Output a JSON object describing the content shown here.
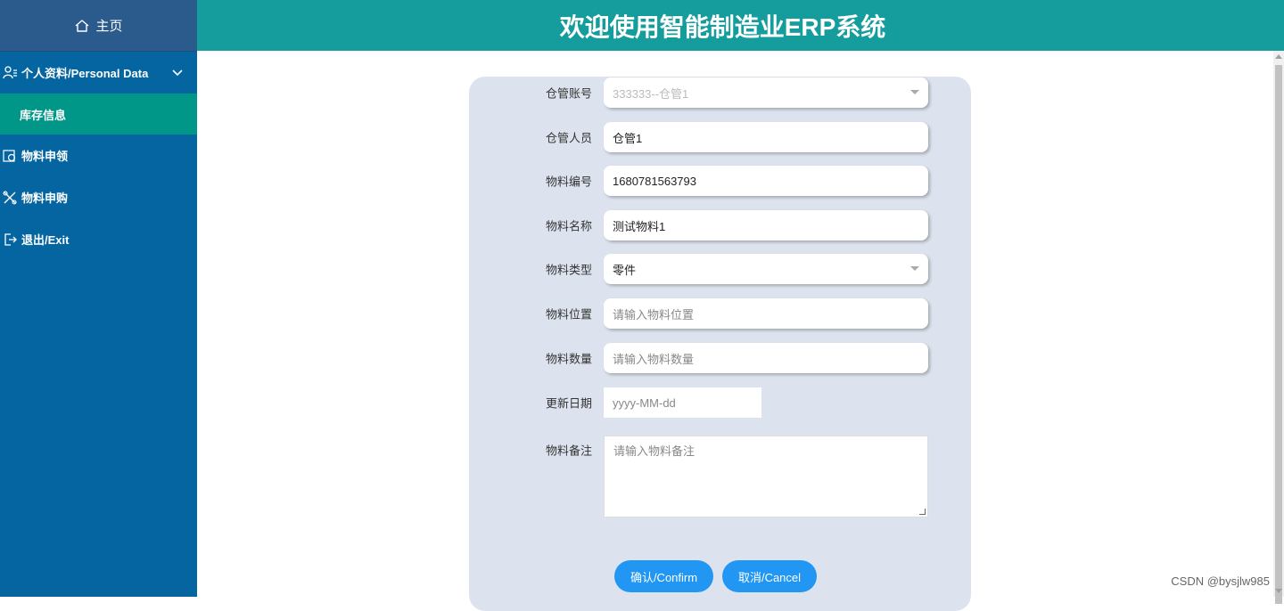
{
  "header": {
    "title": "欢迎使用智能制造业ERP系统"
  },
  "sidebar": {
    "home_label": "主页",
    "items": [
      {
        "label": "个人资料/Personal Data",
        "icon": "user-settings-icon",
        "expanded": true
      },
      {
        "label": "库存信息",
        "active": true
      },
      {
        "label": "物料申领",
        "icon": "gear-box-icon"
      },
      {
        "label": "物料申购",
        "icon": "tools-icon"
      },
      {
        "label": "退出/Exit",
        "icon": "exit-icon"
      }
    ]
  },
  "form": {
    "fields": [
      {
        "label": "仓管账号",
        "value": "333333--仓管1",
        "type": "select",
        "disabled": true
      },
      {
        "label": "仓管人员",
        "value": "仓管1",
        "type": "text"
      },
      {
        "label": "物料编号",
        "value": "1680781563793",
        "type": "text"
      },
      {
        "label": "物料名称",
        "value": "测试物料1",
        "type": "text"
      },
      {
        "label": "物料类型",
        "value": "零件",
        "type": "select"
      },
      {
        "label": "物料位置",
        "placeholder": "请输入物料位置",
        "type": "text"
      },
      {
        "label": "物料数量",
        "placeholder": "请输入物料数量",
        "type": "text"
      },
      {
        "label": "更新日期",
        "placeholder": "yyyy-MM-dd",
        "type": "date"
      },
      {
        "label": "物料备注",
        "placeholder": "请输入物料备注",
        "type": "textarea"
      }
    ],
    "confirm_label": "确认/Confirm",
    "cancel_label": "取消/Cancel"
  },
  "watermark": "CSDN @bysjlw985",
  "colors": {
    "sidebar_bg": "#0565a0",
    "sidebar_active": "#009688",
    "header_bg": "#159d9d",
    "panel_bg": "#dde3ee",
    "button": "#2196f3"
  }
}
